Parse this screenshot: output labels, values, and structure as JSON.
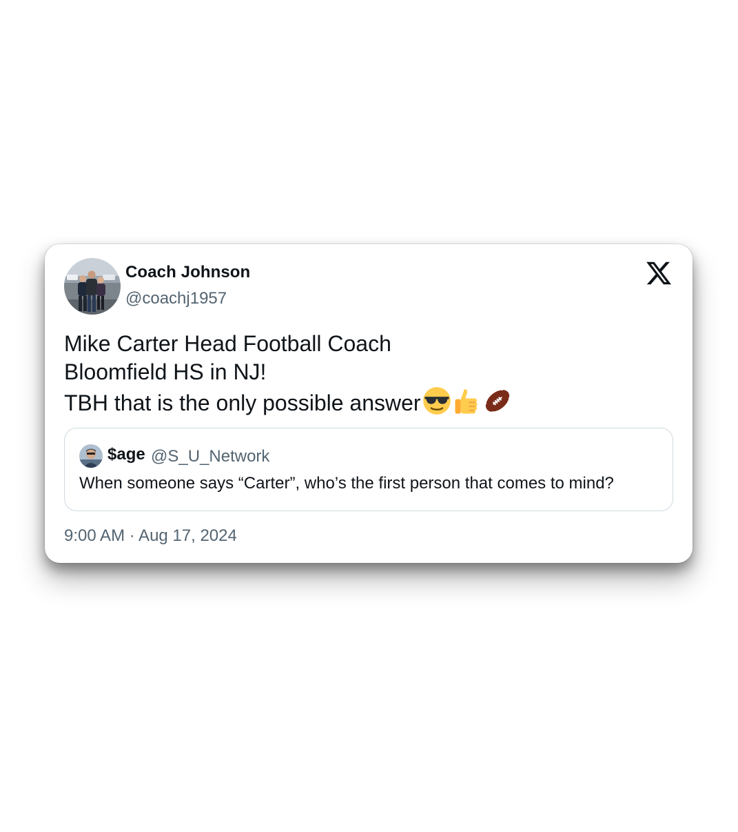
{
  "tweet": {
    "author": {
      "name": "Coach Johnson",
      "handle": "@coachj1957",
      "avatar_icon": "profile-photo-avatar"
    },
    "brand_icon": "x-logo-icon",
    "text_lines": [
      "Mike Carter Head Football Coach",
      "Bloomfield HS in NJ!",
      "TBH that is the only possible answer"
    ],
    "emojis": [
      "sunglasses-face-emoji",
      "thumbs-up-emoji",
      "american-football-emoji"
    ],
    "quoted": {
      "name": "$age",
      "handle": "@S_U_Network",
      "avatar_icon": "profile-photo-avatar",
      "text": "When someone says “Carter”, who’s the first person that comes to mind?"
    },
    "timestamp": "9:00 AM · Aug 17, 2024"
  },
  "colors": {
    "text_primary": "#0f1419",
    "text_secondary": "#536471",
    "quote_border": "#cfd9de",
    "card_background": "#ffffff"
  }
}
